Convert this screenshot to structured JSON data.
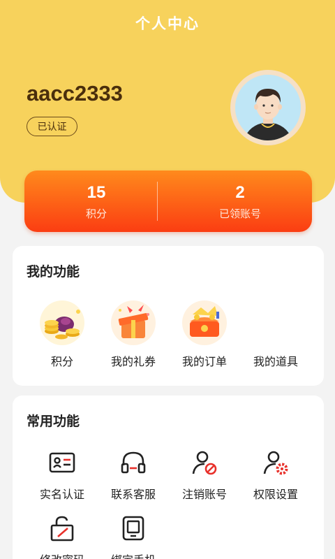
{
  "header": {
    "title": "个人中心"
  },
  "profile": {
    "username": "aacc2333",
    "verified_label": "已认证"
  },
  "stats": [
    {
      "value": "15",
      "label": "积分"
    },
    {
      "value": "2",
      "label": "已领账号"
    }
  ],
  "my_functions": {
    "title": "我的功能",
    "items": [
      {
        "label": "积分",
        "icon": "gold-coins-icon"
      },
      {
        "label": "我的礼券",
        "icon": "gift-box-icon"
      },
      {
        "label": "我的订单",
        "icon": "treasure-chest-icon"
      },
      {
        "label": "我的道具",
        "icon": ""
      }
    ]
  },
  "common_functions": {
    "title": "常用功能",
    "items": [
      {
        "label": "实名认证",
        "icon": "id-card-icon"
      },
      {
        "label": "联系客服",
        "icon": "headphones-icon"
      },
      {
        "label": "注销账号",
        "icon": "user-remove-icon"
      },
      {
        "label": "权限设置",
        "icon": "user-settings-icon"
      },
      {
        "label": "修改密码",
        "icon": "lock-edit-icon"
      },
      {
        "label": "绑定手机",
        "icon": "phone-icon"
      }
    ]
  },
  "colors": {
    "header_bg": "#f7d25c",
    "stats_gradient_top": "#ff8a1c",
    "stats_gradient_bottom": "#fb3d12",
    "accent_red": "#e8302a",
    "page_bg": "#f3f3f3"
  }
}
